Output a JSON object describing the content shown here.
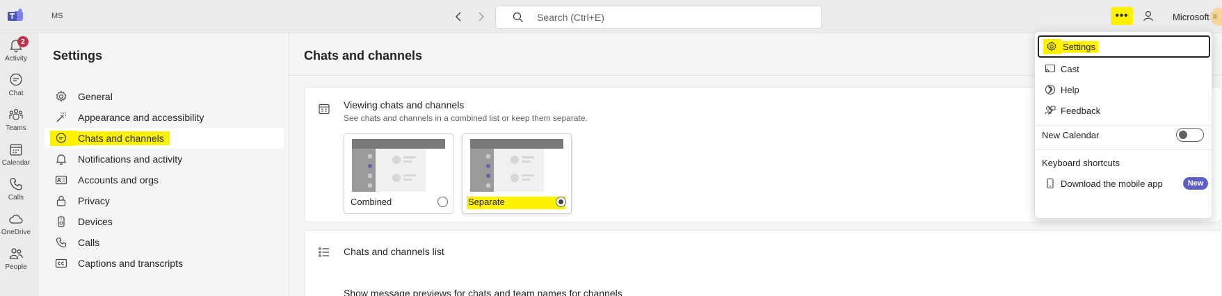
{
  "topbar": {
    "org_label": "MS",
    "search_placeholder": "Search (Ctrl+E)",
    "tenant_name": "Microsoft",
    "avatar_initials": "II"
  },
  "rail": {
    "items": [
      {
        "label": "Activity",
        "icon": "bell-icon",
        "badge": "2"
      },
      {
        "label": "Chat",
        "icon": "chat-icon"
      },
      {
        "label": "Teams",
        "icon": "teams-icon"
      },
      {
        "label": "Calendar",
        "icon": "calendar-icon"
      },
      {
        "label": "Calls",
        "icon": "phone-icon"
      },
      {
        "label": "OneDrive",
        "icon": "cloud-icon"
      },
      {
        "label": "People",
        "icon": "people-icon"
      }
    ]
  },
  "settings": {
    "title": "Settings",
    "items": [
      {
        "label": "General",
        "icon": "gear-icon"
      },
      {
        "label": "Appearance and accessibility",
        "icon": "wand-icon"
      },
      {
        "label": "Chats and channels",
        "icon": "chat-bubble-icon",
        "selected": true
      },
      {
        "label": "Notifications and activity",
        "icon": "bell-icon"
      },
      {
        "label": "Accounts and orgs",
        "icon": "id-card-icon"
      },
      {
        "label": "Privacy",
        "icon": "lock-icon"
      },
      {
        "label": "Devices",
        "icon": "devices-icon"
      },
      {
        "label": "Calls",
        "icon": "phone-icon"
      },
      {
        "label": "Captions and transcripts",
        "icon": "cc-icon"
      }
    ]
  },
  "main": {
    "title": "Chats and channels",
    "viewing": {
      "title": "Viewing chats and channels",
      "subtitle": "See chats and channels in a combined list or keep them separate.",
      "options": [
        {
          "label": "Combined",
          "selected": false
        },
        {
          "label": "Separate",
          "selected": true
        }
      ]
    },
    "list_section": {
      "title": "Chats and channels list",
      "previews_text": "Show message previews for chats and team names for channels"
    }
  },
  "menu": {
    "items": [
      {
        "label": "Settings",
        "icon": "gear-icon",
        "focused": true
      },
      {
        "label": "Cast",
        "icon": "cast-icon"
      },
      {
        "label": "Help",
        "icon": "help-icon",
        "submenu": true
      },
      {
        "label": "Feedback",
        "icon": "feedback-icon",
        "submenu": true
      }
    ],
    "new_calendar_label": "New Calendar",
    "new_calendar_on": false,
    "keyboard_shortcuts_label": "Keyboard shortcuts",
    "download_label": "Download the mobile app",
    "new_badge": "New"
  },
  "colors": {
    "highlight": "#fff200",
    "brand": "#5b5fc7",
    "badge": "#c4314b"
  }
}
